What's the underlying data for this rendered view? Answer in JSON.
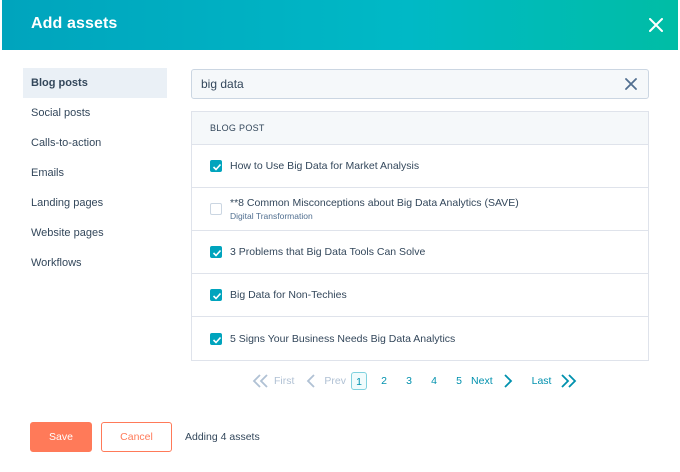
{
  "dialog": {
    "title": "Add assets",
    "close_icon": "close-icon"
  },
  "sidebar": {
    "items": [
      {
        "label": "Blog posts",
        "active": true
      },
      {
        "label": "Social posts",
        "active": false
      },
      {
        "label": "Calls-to-action",
        "active": false
      },
      {
        "label": "Emails",
        "active": false
      },
      {
        "label": "Landing pages",
        "active": false
      },
      {
        "label": "Website pages",
        "active": false
      },
      {
        "label": "Workflows",
        "active": false
      }
    ]
  },
  "search": {
    "value": "big data",
    "placeholder": "",
    "clear_icon": "clear-icon"
  },
  "results": {
    "column_header": "BLOG POST",
    "rows": [
      {
        "title": "How to Use Big Data for Market Analysis",
        "subtitle": "",
        "checked": true
      },
      {
        "title": "**8 Common Misconceptions about Big Data Analytics (SAVE)",
        "subtitle": "Digital Transformation",
        "checked": false
      },
      {
        "title": "3 Problems that Big Data Tools Can Solve",
        "subtitle": "",
        "checked": true
      },
      {
        "title": "Big Data for Non-Techies",
        "subtitle": "",
        "checked": true
      },
      {
        "title": "5 Signs Your Business Needs Big Data Analytics",
        "subtitle": "",
        "checked": true
      }
    ]
  },
  "pagination": {
    "first": "First",
    "prev": "Prev",
    "pages": [
      "1",
      "2",
      "3",
      "4",
      "5"
    ],
    "current": "1",
    "next": "Next",
    "last": "Last"
  },
  "footer": {
    "save_label": "Save",
    "cancel_label": "Cancel",
    "status": "Adding 4 assets"
  },
  "colors": {
    "header_gradient_start": "#00a4bd",
    "header_gradient_end": "#00bda5",
    "accent": "#00a4bd",
    "primary_button": "#ff7a59",
    "link": "#0091ae"
  }
}
